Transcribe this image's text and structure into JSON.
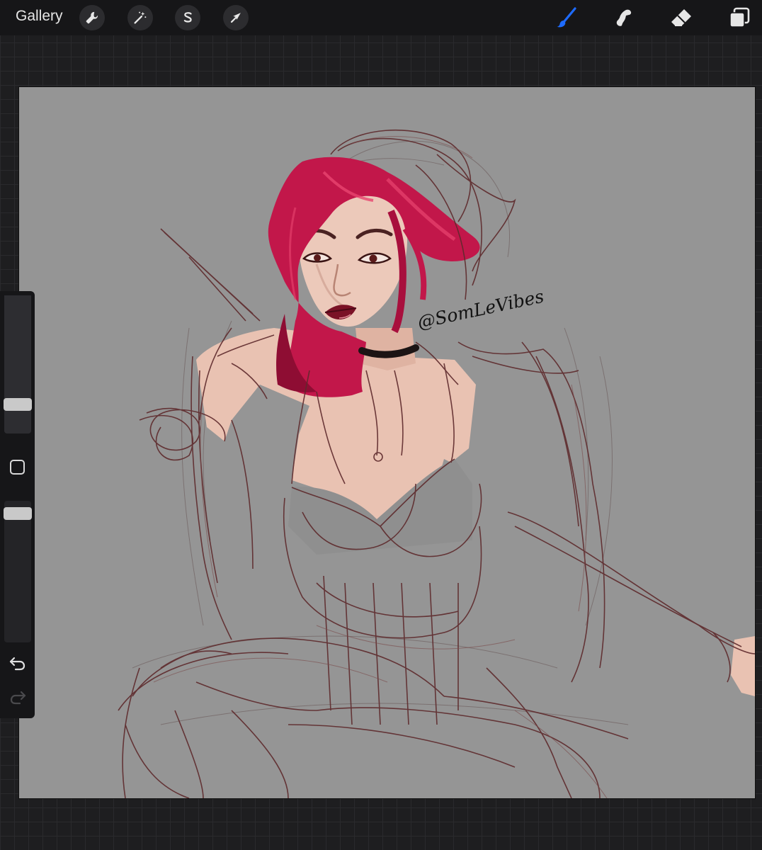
{
  "toolbar": {
    "gallery_label": "Gallery",
    "left_tools": [
      "wrench-icon",
      "magic-wand-icon",
      "selection-icon",
      "transform-arrow-icon"
    ],
    "right_tools": [
      "brush-icon",
      "smudge-icon",
      "eraser-icon",
      "layers-icon"
    ],
    "active_tool": "brush",
    "active_color": "#1e6bff"
  },
  "sidebar": {
    "brush_size_fraction": 0.18,
    "opacity_fraction": 0.95,
    "undo": "undo-icon",
    "redo": "redo-icon",
    "redo_enabled": false
  },
  "canvas": {
    "background_color": "#959595",
    "watermark": "@SomLeVibes",
    "sketch_color": "#5e2a2c",
    "hair_color": "#c2174a",
    "skin_color": "#e9c2b2"
  }
}
